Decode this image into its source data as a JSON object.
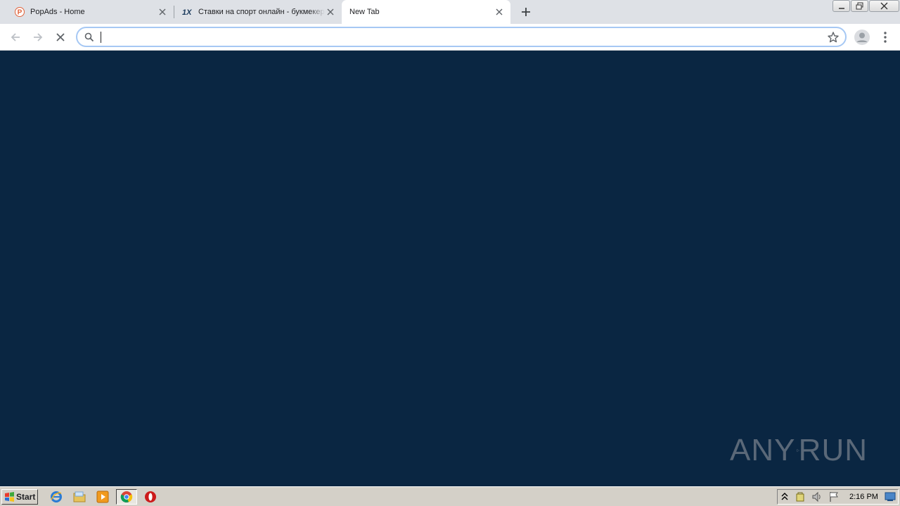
{
  "browser": {
    "tabs": [
      {
        "title": "PopAds - Home",
        "favicon": "popads-icon"
      },
      {
        "title": "Ставки на спорт онлайн - букмекерская контора",
        "favicon": "1xbet-icon"
      },
      {
        "title": "New Tab",
        "favicon": null
      }
    ],
    "new_tab_symbol": "+",
    "window_controls": [
      "minimize",
      "restore",
      "close"
    ],
    "toolbar": {
      "back_icon": "back-arrow-icon",
      "forward_icon": "forward-arrow-icon",
      "stop_icon": "stop-loading-icon",
      "address_value": "",
      "star_icon": "bookmark-star-icon",
      "profile_icon": "profile-avatar-icon",
      "menu_icon": "kebab-menu-icon"
    }
  },
  "content": {
    "background_color": "#0a2642",
    "watermark": {
      "text_left": "ANY",
      "text_right": "RUN"
    }
  },
  "taskbar": {
    "start_label": "Start",
    "clock": "2:16 PM",
    "pinned": [
      "internet-explorer-icon",
      "folder-icon",
      "media-player-icon",
      "chrome-icon",
      "opera-icon"
    ]
  }
}
